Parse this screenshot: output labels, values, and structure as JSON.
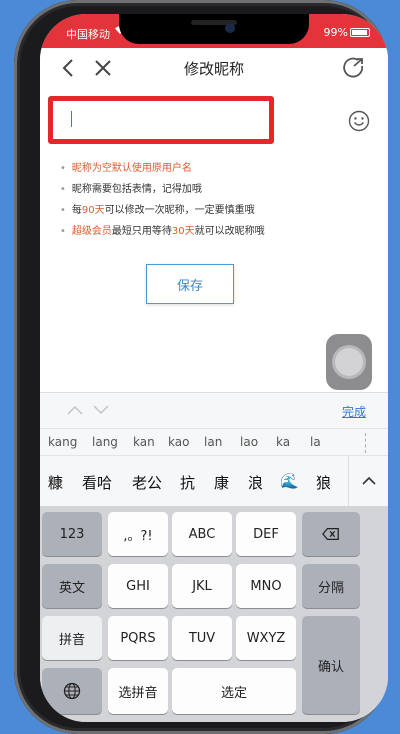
{
  "status_bar": {
    "carrier": "中国移动",
    "battery": "99%"
  },
  "nav": {
    "title": "修改昵称"
  },
  "nickname_input": {
    "value": ""
  },
  "tips": [
    {
      "text": "昵称为空默认使用原用户名",
      "highlight": true
    },
    {
      "text": "昵称需要包括表情，记得加哦",
      "highlight": false
    },
    {
      "parts": [
        "每",
        "90天",
        "可以修改一次昵称，一定要慎重哦"
      ]
    },
    {
      "parts": [
        "超级会员",
        "最短只用等待",
        "30天",
        "就可以改昵称哦"
      ]
    }
  ],
  "save_button": {
    "label": "保存"
  },
  "candidate_toolbar": {
    "done_label": "完成"
  },
  "pinyin_candidates": [
    "kang",
    "lang",
    "kan",
    "kao",
    "lan",
    "lao",
    "ka",
    "la"
  ],
  "word_candidates": [
    "糠",
    "看哈",
    "老公",
    "抗",
    "康",
    "浪",
    "🌊",
    "狼"
  ],
  "keyboard": {
    "keys": {
      "num": "123",
      "punct": ",。?!",
      "abc": "ABC",
      "def": "DEF",
      "en": "英文",
      "ghi": "GHI",
      "jkl": "JKL",
      "mno": "MNO",
      "fenge": "分隔",
      "pinyin": "拼音",
      "pqrs": "PQRS",
      "tuv": "TUV",
      "wxyz": "WXYZ",
      "confirm": "确认",
      "select_pinyin": "选拼音",
      "select": "选定"
    }
  },
  "colors": {
    "accent": "#2e7bd2",
    "highlight_border": "#e5262b",
    "warning_text": "#e05a2b",
    "status_bar": "#e3343c"
  }
}
